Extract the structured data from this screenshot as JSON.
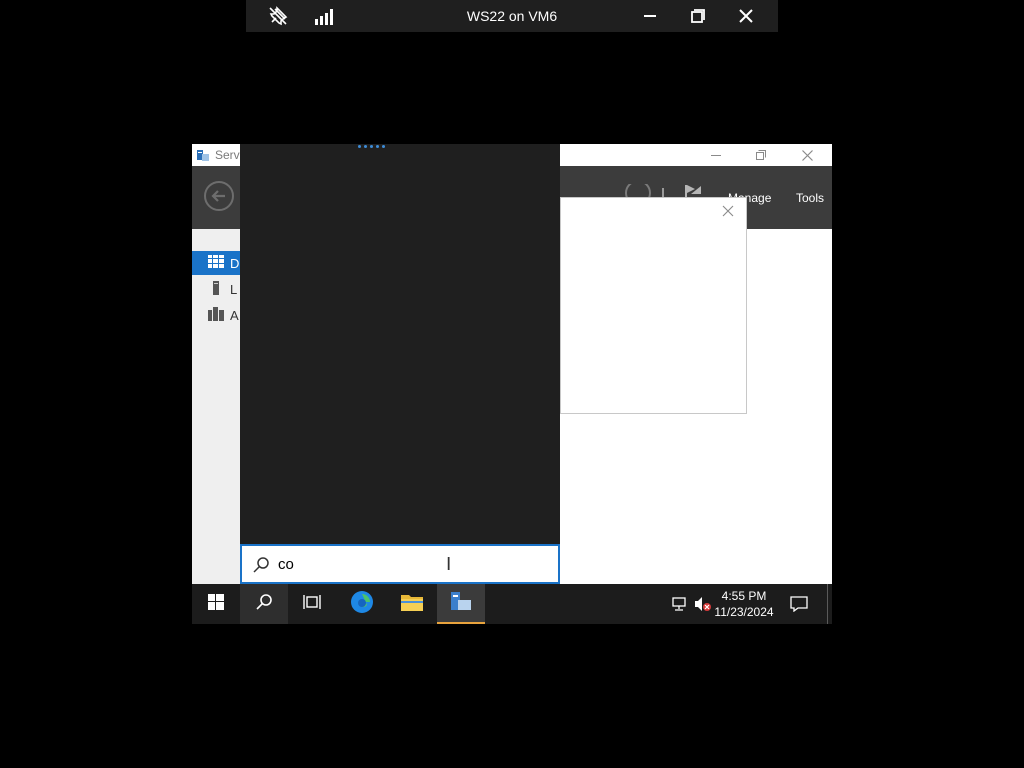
{
  "remote_session": {
    "title": "WS22 on VM6"
  },
  "server_manager": {
    "title": "Serv",
    "menu": {
      "manage": "Manage",
      "tools": "Tools"
    },
    "nav": [
      {
        "label": "D"
      },
      {
        "label": "L"
      },
      {
        "label": "A"
      }
    ]
  },
  "search": {
    "value": "co"
  },
  "clock": {
    "time": "4:55 PM",
    "date": "11/23/2024"
  },
  "colors": {
    "accent": "#1a73c8",
    "taskbar": "#1c1c1c",
    "start_panel": "#1f1f1f"
  }
}
